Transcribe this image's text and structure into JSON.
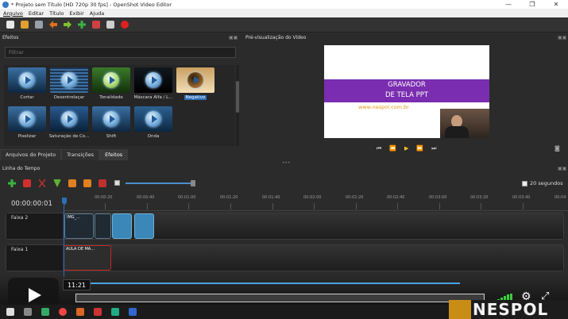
{
  "window": {
    "title": "* Projeto sem Título [HD 720p 30 fps] - OpenShot Video Editor",
    "minimize": "—",
    "maximize": "❐",
    "close": "✕"
  },
  "menu": [
    "Arquivo",
    "Editar",
    "Título",
    "Exibir",
    "Ajuda"
  ],
  "panels": {
    "effects_title": "Efeitos",
    "preview_title": "Pré-visualização do Vídeo",
    "timeline_title": "Linha do Tempo"
  },
  "filter": {
    "placeholder": "Filtrar"
  },
  "effects": [
    {
      "label": "Cortar"
    },
    {
      "label": "Desentrelaçar"
    },
    {
      "label": "Tonalidade"
    },
    {
      "label": "Máscara Alfa / L..."
    },
    {
      "label": "Negativo",
      "selected": true
    },
    {
      "label": "Pixelizar"
    },
    {
      "label": "Saturação de Co..."
    },
    {
      "label": "Shift"
    },
    {
      "label": "Onda"
    }
  ],
  "tabs": [
    {
      "label": "Arquivos do Projeto"
    },
    {
      "label": "Transições"
    },
    {
      "label": "Efeitos",
      "active": true
    }
  ],
  "preview": {
    "line1": "GRAVADOR",
    "line2": "DE TELA PPT",
    "url": "www.nespol.com.br",
    "controls": [
      "⏮",
      "⏪",
      "▶",
      "⏩",
      "⏭"
    ]
  },
  "timeline": {
    "timecode": "00:00:00:01",
    "zoom_label": "20 segundos",
    "ticks": [
      "00:00:20",
      "00:00:40",
      "00:01:00",
      "00:01:20",
      "00:01:40",
      "00:02:00",
      "00:02:20",
      "00:02:40",
      "00:03:00",
      "00:03:20",
      "00:03:40",
      "00:04"
    ],
    "tracks": [
      {
        "name": "Faixa 2",
        "clips": [
          {
            "label": "IMG_..."
          },
          {
            "label": ""
          },
          {
            "label": ""
          },
          {
            "label": ""
          }
        ]
      },
      {
        "name": "Faixa 1",
        "clips": [
          {
            "label": "AULA DE MA..."
          }
        ]
      }
    ]
  },
  "player": {
    "timestamp": "11:21",
    "progress": 0.0
  },
  "brand": {
    "name": "NESPOL"
  },
  "colors": {
    "accent": "#2f6eb5",
    "preview_band": "#7a2db0",
    "url": "#e29a16",
    "brand_mark": "#c98d16"
  }
}
